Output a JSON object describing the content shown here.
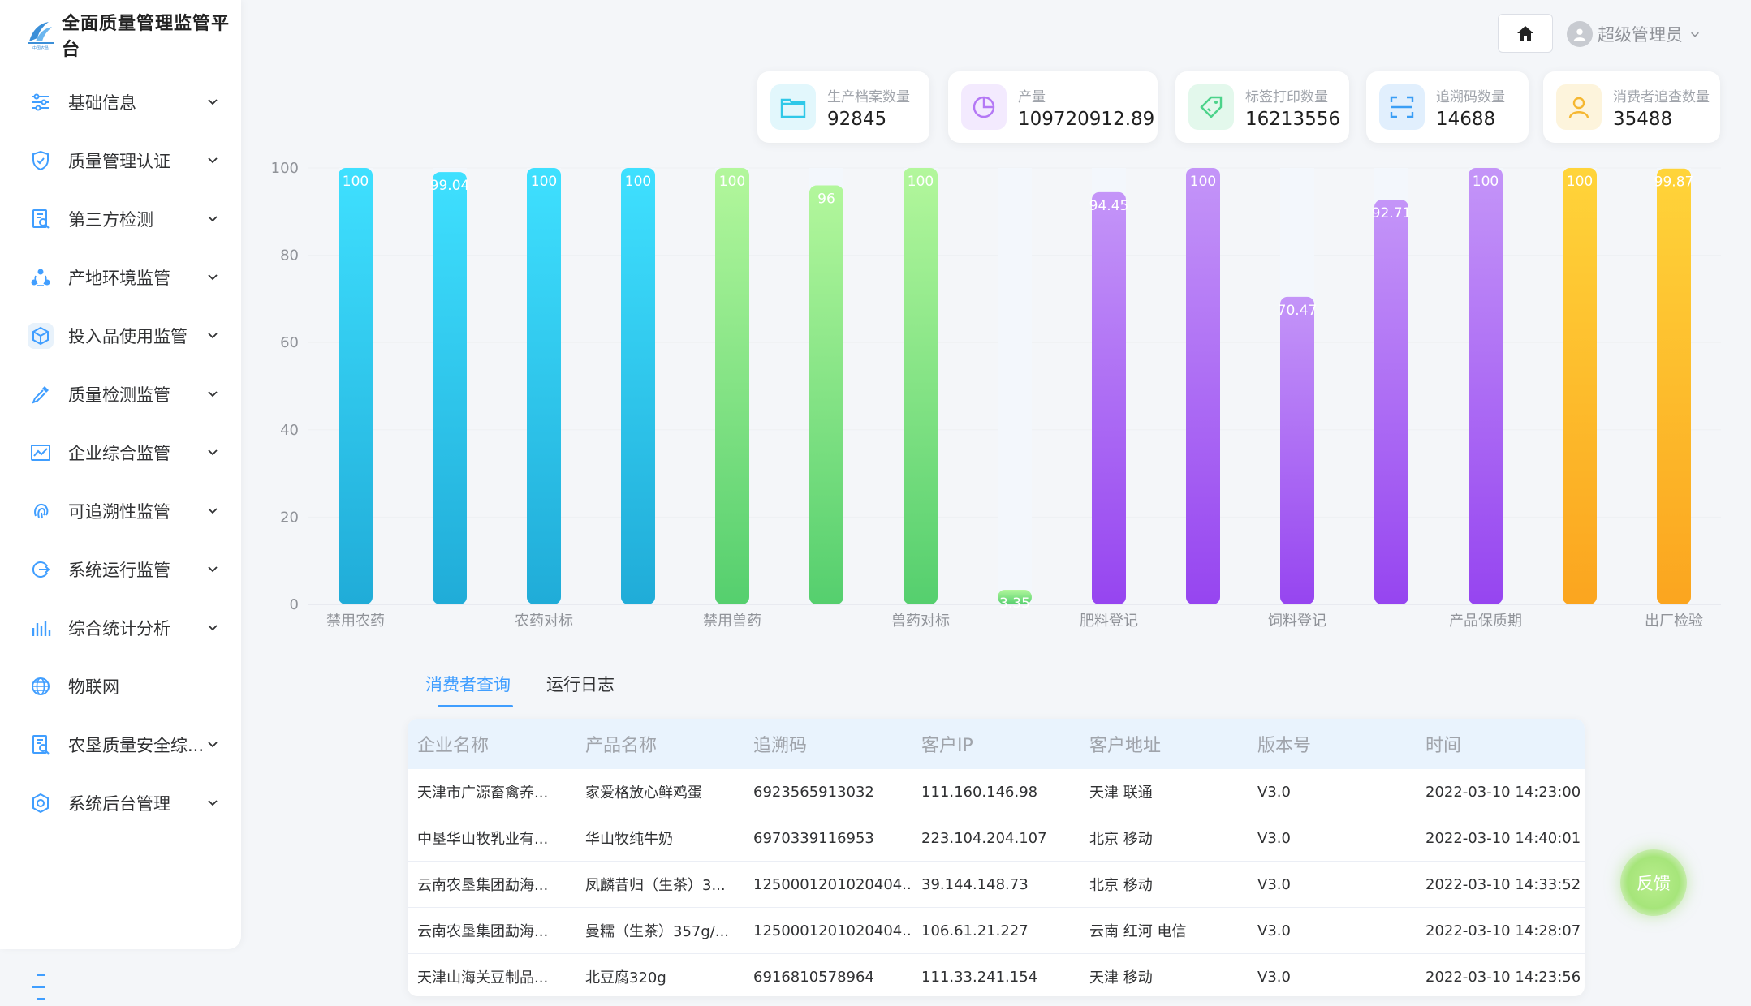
{
  "app": {
    "title": "全面质量管理监管平台",
    "logo_text": "中国农垦"
  },
  "sidebar": {
    "items": [
      {
        "label": "基础信息",
        "icon": "sliders-icon",
        "has_children": true
      },
      {
        "label": "质量管理认证",
        "icon": "shield-check-icon",
        "has_children": true
      },
      {
        "label": "第三方检测",
        "icon": "document-search-icon",
        "has_children": true
      },
      {
        "label": "产地环境监管",
        "icon": "network-nodes-icon",
        "has_children": true
      },
      {
        "label": "投入品使用监管",
        "icon": "cube-icon",
        "has_children": true,
        "active": true
      },
      {
        "label": "质量检测监管",
        "icon": "pipette-icon",
        "has_children": true
      },
      {
        "label": "企业综合监管",
        "icon": "line-chart-icon",
        "has_children": true
      },
      {
        "label": "可追溯性监管",
        "icon": "fingerprint-icon",
        "has_children": true
      },
      {
        "label": "系统运行监管",
        "icon": "arrow-circle-icon",
        "has_children": true
      },
      {
        "label": "综合统计分析",
        "icon": "bar-chart-icon",
        "has_children": true
      },
      {
        "label": "物联网",
        "icon": "globe-icon",
        "has_children": false
      },
      {
        "label": "农垦质量安全综...",
        "icon": "document-search-icon",
        "has_children": true
      },
      {
        "label": "系统后台管理",
        "icon": "gear-icon",
        "has_children": true
      }
    ]
  },
  "header": {
    "user_name": "超级管理员"
  },
  "stats": [
    {
      "label": "生产档案数量",
      "value": "92845",
      "icon": "folder-icon",
      "color": "#2fc8e8",
      "bg": "#e2f7fc"
    },
    {
      "label": "产量",
      "value": "109720912.89",
      "icon": "pie-chart-icon",
      "color": "#b478f5",
      "bg": "#f3eafe"
    },
    {
      "label": "标签打印数量",
      "value": "16213556",
      "icon": "tag-icon",
      "color": "#4cd38a",
      "bg": "#e3f8ec"
    },
    {
      "label": "追溯码数量",
      "value": "14688",
      "icon": "scan-icon",
      "color": "#3a9ef5",
      "bg": "#e1effd"
    },
    {
      "label": "消费者追查数量",
      "value": "35488",
      "icon": "user-icon",
      "color": "#f5b731",
      "bg": "#fdf4dc"
    }
  ],
  "chart_data": {
    "type": "bar",
    "categories": [
      "禁用农药",
      "",
      "农药对标",
      "",
      "禁用兽药",
      "",
      "兽药对标",
      "",
      "肥料登记",
      "",
      "饲料登记",
      "",
      "产品保质期",
      "",
      "出厂检验"
    ],
    "values": [
      100,
      99.04,
      100,
      100,
      100,
      96,
      100,
      3.35,
      94.45,
      100,
      70.47,
      92.71,
      100,
      100,
      99.87
    ],
    "colors": [
      "cyan",
      "cyan",
      "cyan",
      "cyan",
      "green",
      "green",
      "green",
      "green",
      "purple",
      "purple",
      "purple",
      "purple",
      "purple",
      "orange",
      "orange"
    ],
    "ylim": [
      0,
      100
    ],
    "yticks": [
      0,
      20,
      40,
      60,
      80,
      100
    ],
    "grid": true
  },
  "tabs": [
    {
      "label": "消费者查询",
      "active": true
    },
    {
      "label": "运行日志",
      "active": false
    }
  ],
  "table": {
    "columns": [
      "企业名称",
      "产品名称",
      "追溯码",
      "客户IP",
      "客户地址",
      "版本号",
      "时间"
    ],
    "rows": [
      [
        "天津市广源畜禽养...",
        "家爱格放心鲜鸡蛋",
        "6923565913032",
        "111.160.146.98",
        "天津 联通",
        "V3.0",
        "2022-03-10 14:23:00"
      ],
      [
        "中垦华山牧乳业有...",
        "华山牧纯牛奶",
        "6970339116953",
        "223.104.204.107",
        "北京 移动",
        "V3.0",
        "2022-03-10 14:40:01"
      ],
      [
        "云南农垦集团勐海...",
        "凤麟昔归（生茶）3...",
        "1250001201020404...",
        "39.144.148.73",
        "北京 移动",
        "V3.0",
        "2022-03-10 14:33:52"
      ],
      [
        "云南农垦集团勐海...",
        "曼糯（生茶）357g/...",
        "1250001201020404...",
        "106.61.21.227",
        "云南 红河 电信",
        "V3.0",
        "2022-03-10 14:28:07"
      ],
      [
        "天津山海关豆制品...",
        "北豆腐320g",
        "6916810578964",
        "111.33.241.154",
        "天津 移动",
        "V3.0",
        "2022-03-10 14:23:56"
      ]
    ]
  },
  "feedback_label": "反馈"
}
